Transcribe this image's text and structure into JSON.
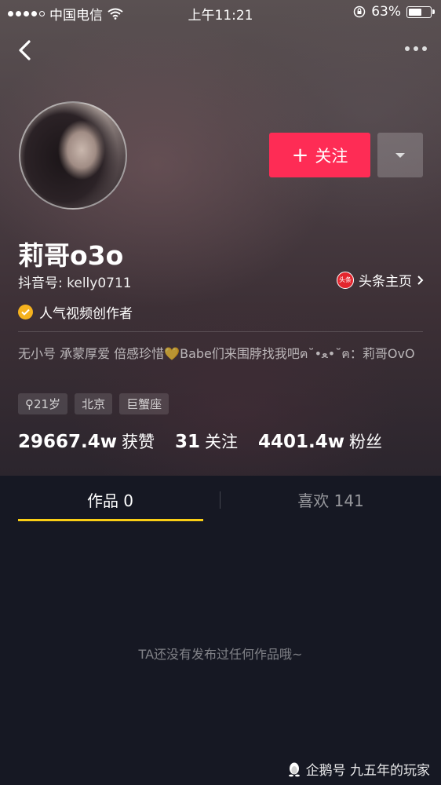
{
  "status_bar": {
    "carrier": "中国电信",
    "time": "上午11:21",
    "battery_percent": "63%",
    "battery_level": 0.63,
    "signal_bars": 4,
    "signal_total": 5
  },
  "header": {
    "back_icon": "chevron-left-icon",
    "more_icon": "more-dots-icon"
  },
  "profile": {
    "follow_label": "关注",
    "follow_plus": "+",
    "follow_color": "#fe2c55",
    "nickname": "莉哥o3o",
    "douyin_id": "抖音号: kelly0711",
    "toutiao_logo_text": "头条",
    "toutiao_label": "头条主页",
    "verified_label": "人气视频创作者",
    "verified_color": "#f5b21e",
    "bio": "无小号 承蒙厚爱 倍感珍惜💛Babe们来围脖找我吧ฅ˘•ﻌ•˘ฅ：莉哥OvO",
    "tags": [
      "⚲21岁",
      "北京",
      "巨蟹座"
    ]
  },
  "stats": [
    {
      "value": "29667.4w",
      "label": "获赞"
    },
    {
      "value": "31",
      "label": "关注"
    },
    {
      "value": "4401.4w",
      "label": "粉丝"
    }
  ],
  "tabs": {
    "works": "作品 0",
    "likes": "喜欢 141",
    "active": "works",
    "underline_color": "#face15"
  },
  "empty_message": "TA还没有发布过任何作品哦~",
  "watermark": "企鹅号 九五年的玩家"
}
